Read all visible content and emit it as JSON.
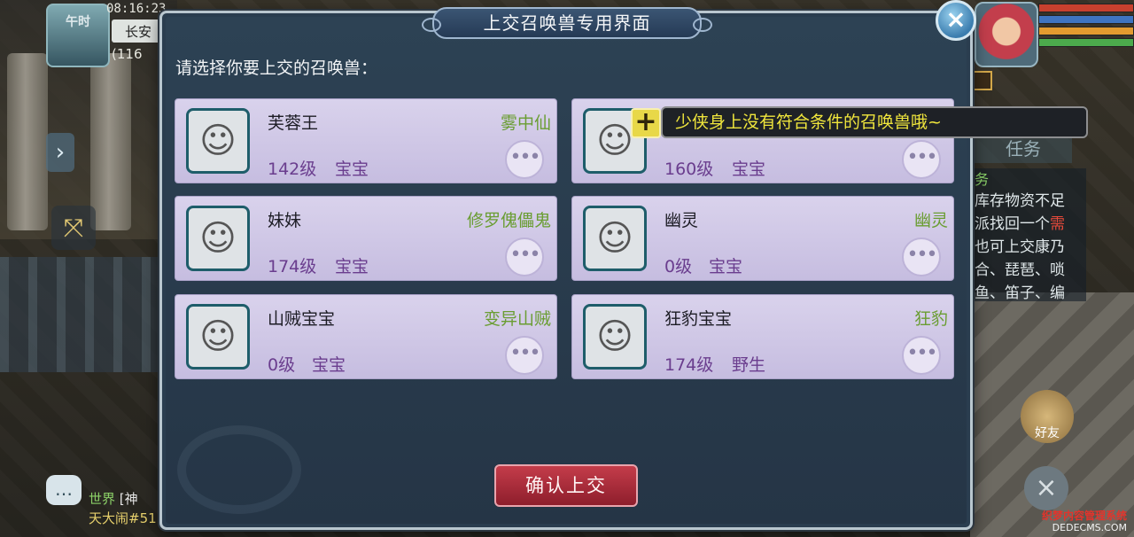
{
  "hud": {
    "period": "午时",
    "clock": "08:16:23",
    "city": "长安",
    "coords": "(116"
  },
  "dialog": {
    "title": "上交召唤兽专用界面",
    "close_label": "×",
    "prompt": "请选择你要上交的召唤兽：",
    "confirm_label": "确认上交",
    "more_label": "•••",
    "pets": [
      {
        "name": "芙蓉王",
        "type": "雾中仙",
        "level": "142级",
        "kind": "宝宝"
      },
      {
        "name": "",
        "type": "",
        "level": "160级",
        "kind": "宝宝"
      },
      {
        "name": "妹妹",
        "type": "修罗傀儡鬼",
        "level": "174级",
        "kind": "宝宝"
      },
      {
        "name": "幽灵",
        "type": "幽灵",
        "level": "0级",
        "kind": "宝宝"
      },
      {
        "name": "山贼宝宝",
        "type": "变异山贼",
        "level": "0级",
        "kind": "宝宝"
      },
      {
        "name": "狂豹宝宝",
        "type": "狂豹",
        "level": "174级",
        "kind": "野生"
      }
    ]
  },
  "tooltip": {
    "text": "少侠身上没有符合条件的召唤兽哦~",
    "icon": "plus-icon"
  },
  "task": {
    "tab_label": "任务",
    "head": "务",
    "lines": [
      "库存物资不足",
      "派找回一个",
      "也可上交康乃",
      "合、琵琶、唢",
      "鱼、笛子、编"
    ],
    "highlight": "需"
  },
  "chat": {
    "channel": "世界",
    "bracket": "[神",
    "line2": "天大闹#51"
  },
  "right_hud": {
    "friend_label": "好友",
    "close_round": "×",
    "watermark_cn": "织梦内容管理系统",
    "watermark_en": "DEDECMS.COM"
  },
  "colors": {
    "accent_bar_red": "#c8402e",
    "accent_bar_green": "#4caa4c",
    "accent_bar_blue": "#3f74c0",
    "accent_bar_orange": "#e39b2f",
    "pet_type_green": "#6a9d32",
    "level_purple": "#6a3d8e",
    "tooltip_yellow": "#f0e63c"
  }
}
